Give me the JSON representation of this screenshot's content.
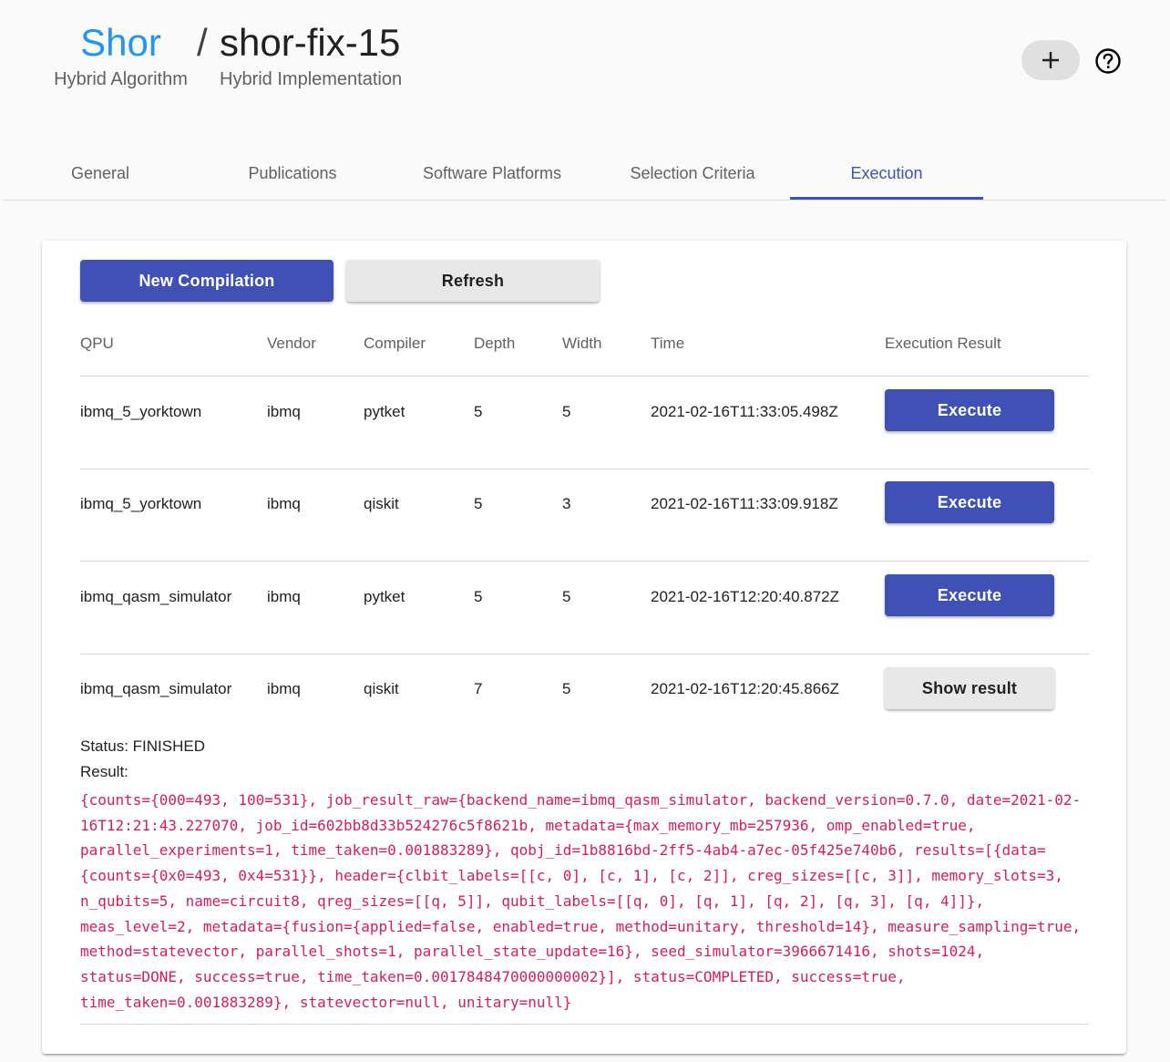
{
  "breadcrumb": {
    "algorithm_name": "Shor",
    "algorithm_type": "Hybrid Algorithm",
    "separator": "/",
    "implementation_name": "shor-fix-15",
    "implementation_type": "Hybrid Implementation"
  },
  "header_actions": {
    "add_icon": "plus-icon",
    "help_icon": "help-circle-icon"
  },
  "tabs": [
    {
      "label": "General",
      "active": false
    },
    {
      "label": "Publications",
      "active": false
    },
    {
      "label": "Software Platforms",
      "active": false
    },
    {
      "label": "Selection Criteria",
      "active": false
    },
    {
      "label": "Execution",
      "active": true
    }
  ],
  "toolbar": {
    "new_compilation_label": "New Compilation",
    "refresh_label": "Refresh"
  },
  "table": {
    "headers": [
      "QPU",
      "Vendor",
      "Compiler",
      "Depth",
      "Width",
      "Time",
      "Execution Result"
    ],
    "rows": [
      {
        "qpu": "ibmq_5_yorktown",
        "vendor": "ibmq",
        "compiler": "pytket",
        "depth": "5",
        "width": "5",
        "time": "2021-02-16T11:33:05.498Z",
        "action": "Execute"
      },
      {
        "qpu": "ibmq_5_yorktown",
        "vendor": "ibmq",
        "compiler": "qiskit",
        "depth": "5",
        "width": "3",
        "time": "2021-02-16T11:33:09.918Z",
        "action": "Execute"
      },
      {
        "qpu": "ibmq_qasm_simulator",
        "vendor": "ibmq",
        "compiler": "pytket",
        "depth": "5",
        "width": "5",
        "time": "2021-02-16T12:20:40.872Z",
        "action": "Execute"
      },
      {
        "qpu": "ibmq_qasm_simulator",
        "vendor": "ibmq",
        "compiler": "qiskit",
        "depth": "7",
        "width": "5",
        "time": "2021-02-16T12:20:45.866Z",
        "action": "Show result"
      }
    ]
  },
  "execution_result": {
    "status_text": "Status: FINISHED",
    "result_label": "Result:",
    "result_raw": "{counts={000=493, 100=531}, job_result_raw={backend_name=ibmq_qasm_simulator, backend_version=0.7.0, date=2021-02-16T12:21:43.227070, job_id=602bb8d33b524276c5f8621b, metadata={max_memory_mb=257936, omp_enabled=true, parallel_experiments=1, time_taken=0.001883289}, qobj_id=1b8816bd-2ff5-4ab4-a7ec-05f425e740b6, results=[{data={counts={0x0=493, 0x4=531}}, header={clbit_labels=[[c, 0], [c, 1], [c, 2]], creg_sizes=[[c, 3]], memory_slots=3, n_qubits=5, name=circuit8, qreg_sizes=[[q, 5]], qubit_labels=[[q, 0], [q, 1], [q, 2], [q, 3], [q, 4]]}, meas_level=2, metadata={fusion={applied=false, enabled=true, method=unitary, threshold=14}, measure_sampling=true, method=statevector, parallel_shots=1, parallel_state_update=16}, seed_simulator=3966671416, shots=1024, status=DONE, success=true, time_taken=0.0017848470000000002}], status=COMPLETED, success=true, time_taken=0.001883289}, statevector=null, unitary=null}"
  },
  "colors": {
    "primary": "#3f51b5",
    "link": "#2196f3",
    "code": "#d81b60"
  }
}
